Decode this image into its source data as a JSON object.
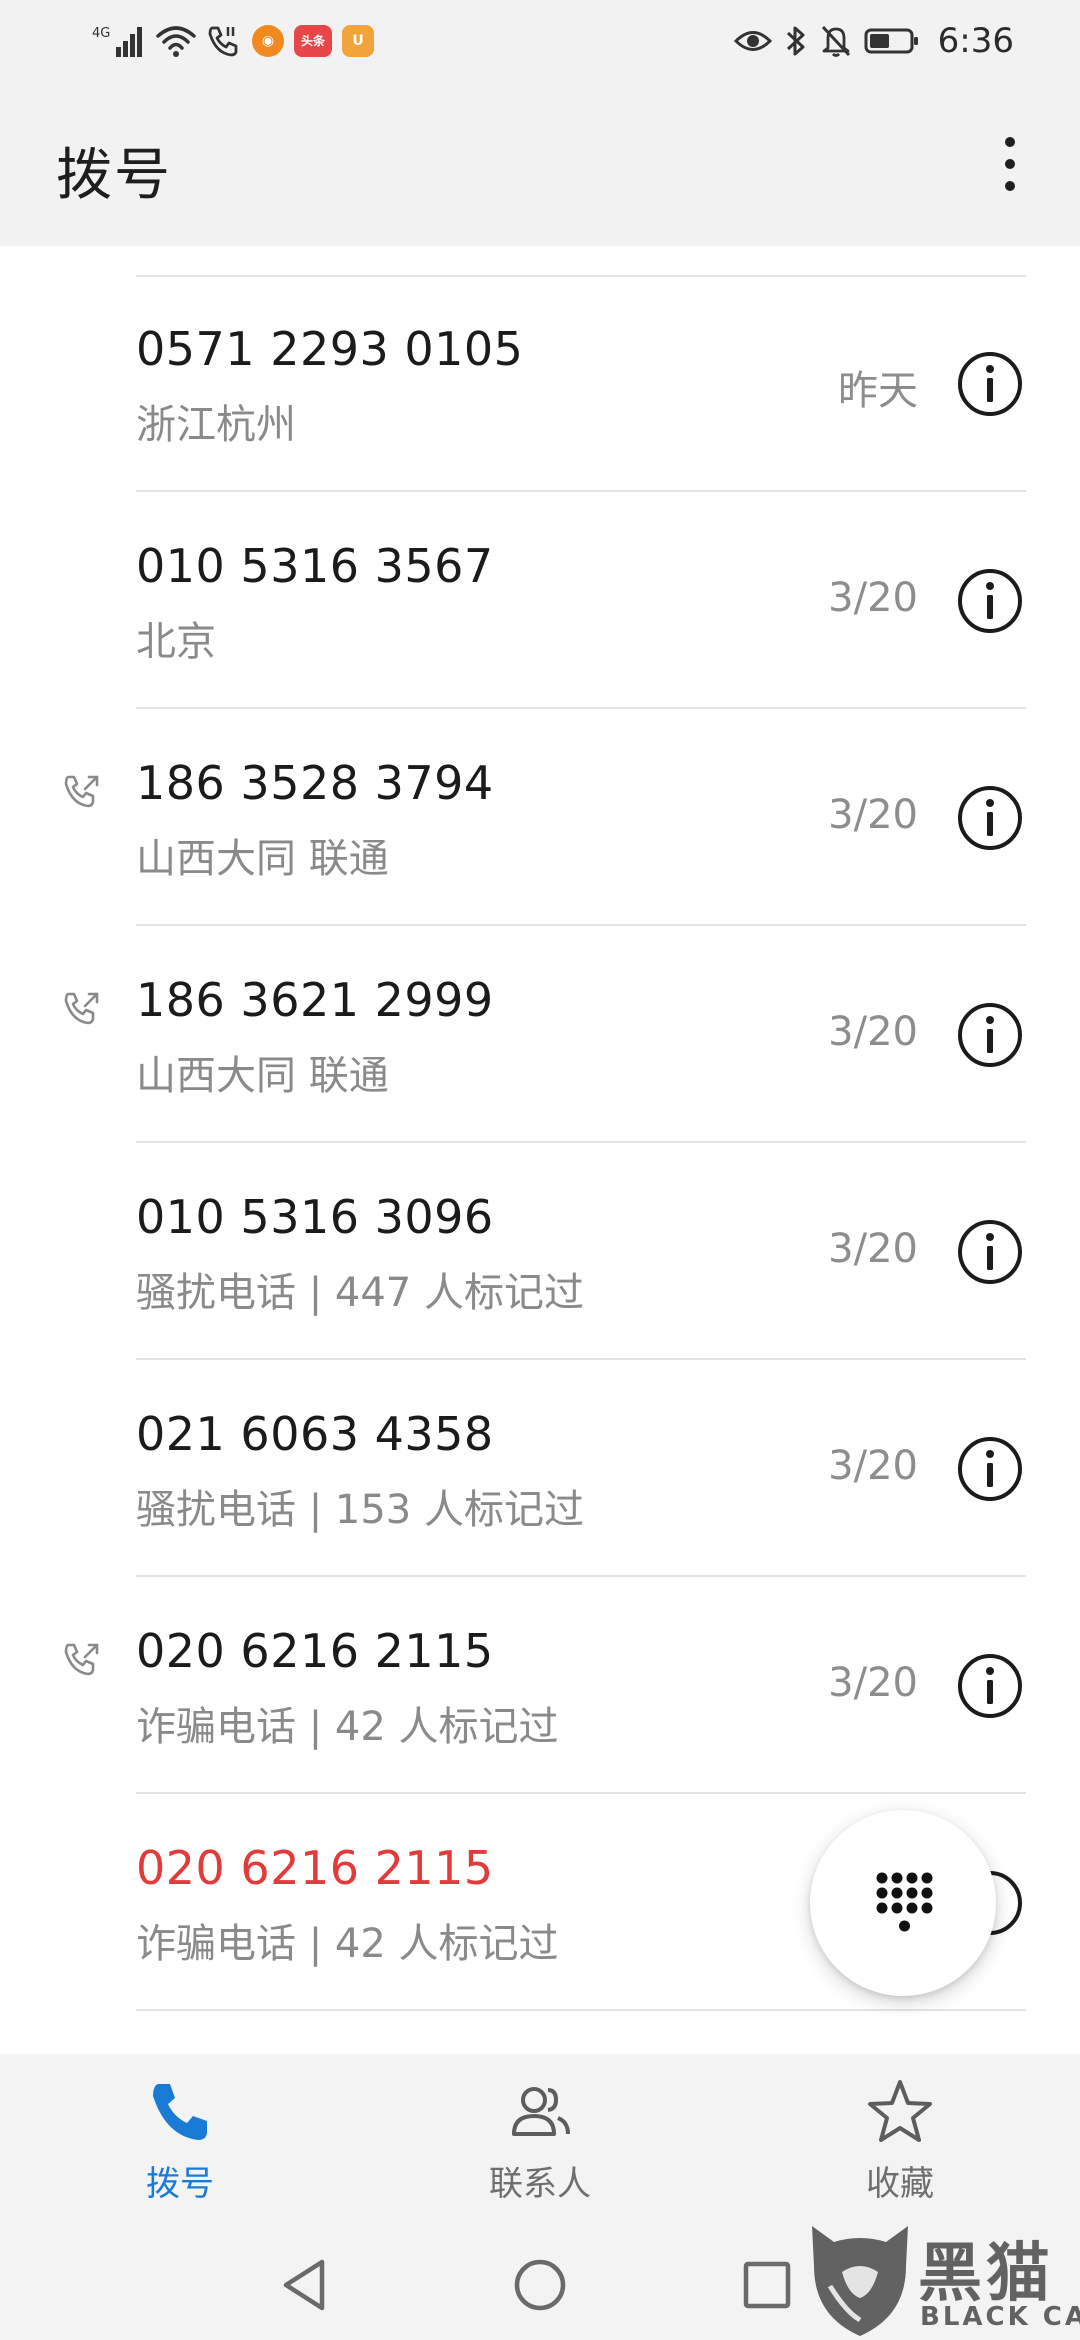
{
  "status_bar": {
    "network_label": "4G",
    "time": "6:36",
    "apps": [
      {
        "name": "squirrel-app",
        "color": "#f08a1f",
        "glyph": "◉"
      },
      {
        "name": "toutiao-app",
        "color": "#e8474a",
        "glyph": "头条"
      },
      {
        "name": "uc-app",
        "color": "#f2a43a",
        "glyph": "U"
      }
    ]
  },
  "header": {
    "title": "拨号"
  },
  "calls": [
    {
      "number": "0571 2293 0105",
      "detail": "浙江杭州",
      "date": "昨天",
      "outgoing": false,
      "missed": false
    },
    {
      "number": "010 5316 3567",
      "detail": "北京",
      "date": "3/20",
      "outgoing": false,
      "missed": false
    },
    {
      "number": "186 3528 3794",
      "detail": "山西大同 联通",
      "date": "3/20",
      "outgoing": true,
      "missed": false
    },
    {
      "number": "186 3621 2999",
      "detail": "山西大同 联通",
      "date": "3/20",
      "outgoing": true,
      "missed": false
    },
    {
      "number": "010 5316 3096",
      "detail": "骚扰电话 | 447 人标记过",
      "date": "3/20",
      "outgoing": false,
      "missed": false
    },
    {
      "number": "021 6063 4358",
      "detail": "骚扰电话 | 153 人标记过",
      "date": "3/20",
      "outgoing": false,
      "missed": false
    },
    {
      "number": "020 6216 2115",
      "detail": "诈骗电话 | 42 人标记过",
      "date": "3/20",
      "outgoing": true,
      "missed": false
    },
    {
      "number": "020 6216 2115",
      "detail": "诈骗电话 | 42 人标记过",
      "date": "",
      "outgoing": false,
      "missed": true
    }
  ],
  "tabs": [
    {
      "label": "拨号",
      "icon": "phone-icon",
      "active": true
    },
    {
      "label": "联系人",
      "icon": "contacts-icon",
      "active": false
    },
    {
      "label": "收藏",
      "icon": "star-icon",
      "active": false
    }
  ],
  "watermark": {
    "text_cn": "黑猫",
    "text_en": "BLACK CAT"
  },
  "colors": {
    "accent": "#1a7bd7",
    "missed": "#e23b3b",
    "header_bg": "#f2f2f2"
  }
}
